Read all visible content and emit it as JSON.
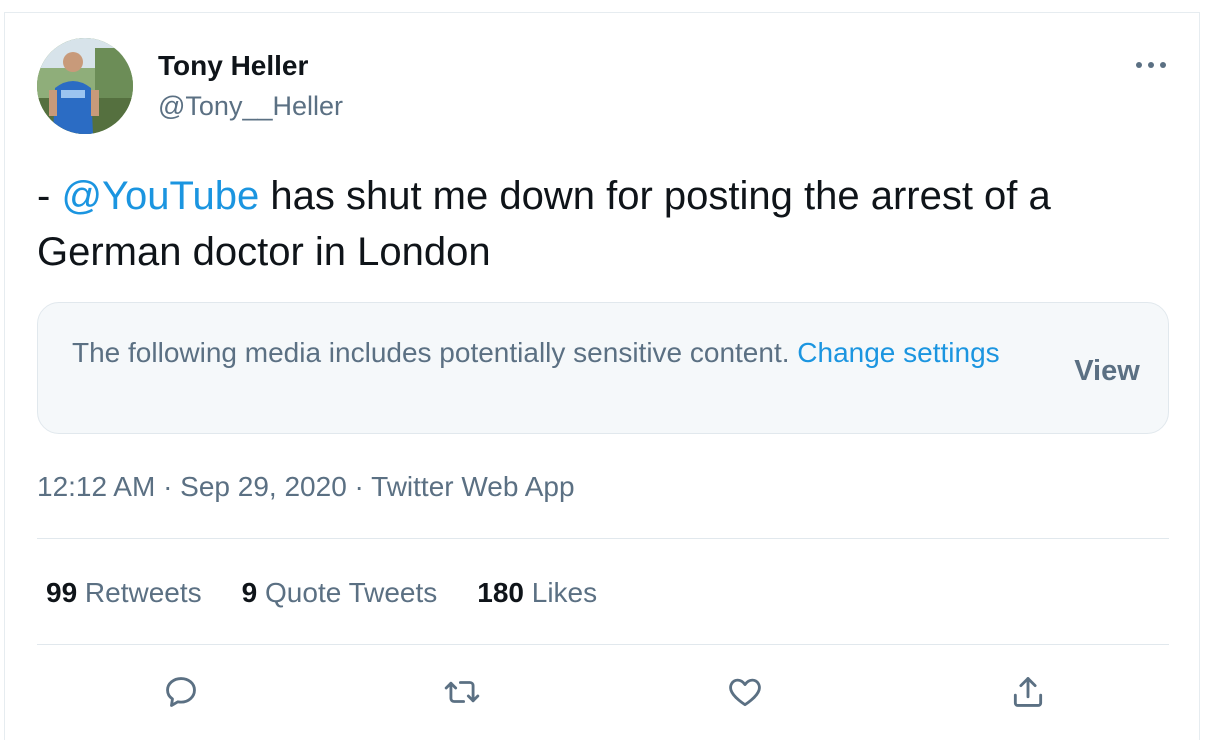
{
  "user": {
    "name": "Tony Heller",
    "handle": "@Tony__Heller"
  },
  "tweet": {
    "prefix": "- ",
    "mention": "@YouTube",
    "body": " has shut me down for posting the arrest of a German doctor in London"
  },
  "sensitive_notice": {
    "text": "The following media includes potentially sensitive content. ",
    "link": "Change settings",
    "view_label": "View"
  },
  "meta": {
    "line": "12:12 AM · Sep 29, 2020 · Twitter Web App"
  },
  "stats": {
    "retweets_count": "99",
    "retweets_label": " Retweets",
    "quotes_count": "9",
    "quotes_label": " Quote Tweets",
    "likes_count": "180",
    "likes_label": " Likes"
  },
  "colors": {
    "accent": "#1b95e0",
    "secondary_text": "#5b7083",
    "primary_text": "#0f1419",
    "border": "#e1e8ed"
  },
  "icons": {
    "more": "more-dots-icon",
    "reply": "reply-icon",
    "retweet": "retweet-icon",
    "like": "heart-icon",
    "share": "share-icon"
  }
}
